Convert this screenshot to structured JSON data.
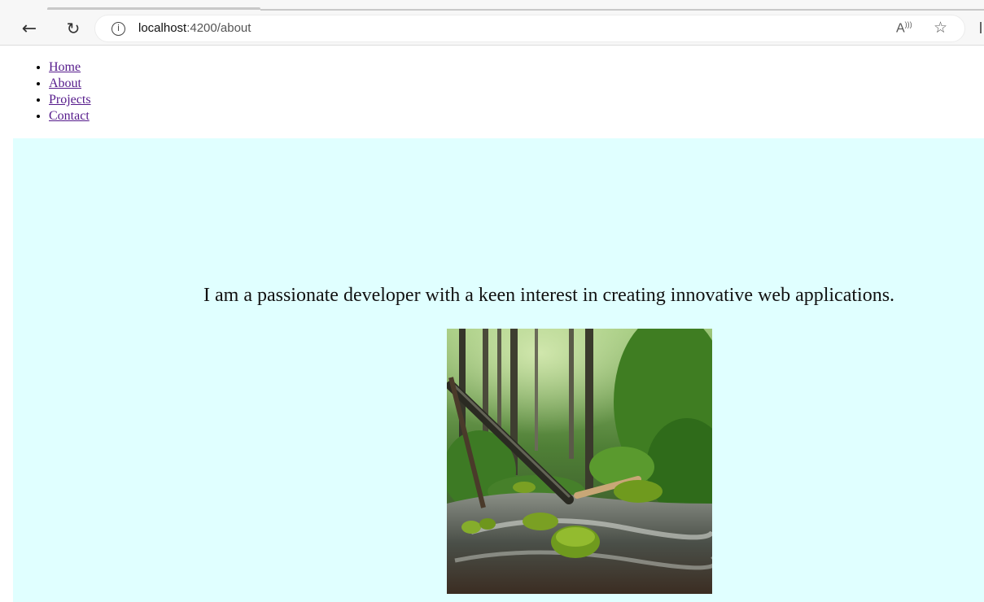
{
  "browser": {
    "url_host": "localhost",
    "url_path": ":4200/about",
    "back_icon": "arrow-left-icon",
    "reload_icon": "reload-icon",
    "info_icon": "info-icon",
    "read_aloud_label": "A",
    "favorite_icon": "star-icon"
  },
  "nav": {
    "items": [
      {
        "label": "Home"
      },
      {
        "label": "About"
      },
      {
        "label": "Projects"
      },
      {
        "label": "Contact"
      }
    ]
  },
  "about": {
    "text": "I am a passionate developer with a keen interest in creating innovative web applications.",
    "background": "#e0ffff",
    "image": "forest-stream-photo"
  }
}
